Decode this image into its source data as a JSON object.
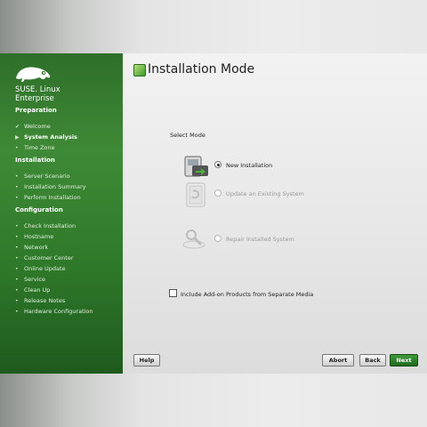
{
  "brand": {
    "line1": "SUSE. Linux",
    "line2": "Enterprise"
  },
  "sidebar": {
    "sections": [
      {
        "title": "Preparation",
        "items": [
          {
            "label": "Welcome",
            "state": "done"
          },
          {
            "label": "System Analysis",
            "state": "active"
          },
          {
            "label": "Time Zone",
            "state": "todo"
          }
        ]
      },
      {
        "title": "Installation",
        "items": [
          {
            "label": "Server Scenario",
            "state": "todo"
          },
          {
            "label": "Installation Summary",
            "state": "todo"
          },
          {
            "label": "Perform Installation",
            "state": "todo"
          }
        ]
      },
      {
        "title": "Configuration",
        "items": [
          {
            "label": "Check Installation",
            "state": "todo"
          },
          {
            "label": "Hostname",
            "state": "todo"
          },
          {
            "label": "Network",
            "state": "todo"
          },
          {
            "label": "Customer Center",
            "state": "todo"
          },
          {
            "label": "Online Update",
            "state": "todo"
          },
          {
            "label": "Service",
            "state": "todo"
          },
          {
            "label": "Clean Up",
            "state": "todo"
          },
          {
            "label": "Release Notes",
            "state": "todo"
          },
          {
            "label": "Hardware Configuration",
            "state": "todo"
          }
        ]
      }
    ]
  },
  "main": {
    "title": "Installation Mode",
    "select_mode_label": "Select Mode",
    "options": [
      {
        "label": "New Installation",
        "selected": true,
        "enabled": true,
        "icon": "new-install-icon"
      },
      {
        "label": "Update an Existing System",
        "selected": false,
        "enabled": false,
        "icon": "update-icon"
      },
      {
        "label": "Repair Installed System",
        "selected": false,
        "enabled": false,
        "icon": "repair-icon"
      }
    ],
    "addon_label": "Include Add-on Products from Separate Media",
    "addon_checked": false
  },
  "buttons": {
    "help": "Help",
    "abort": "Abort",
    "back": "Back",
    "next": "Next"
  },
  "colors": {
    "sidebar_green": "#3f8a36",
    "next_button": "#2a7d26"
  }
}
